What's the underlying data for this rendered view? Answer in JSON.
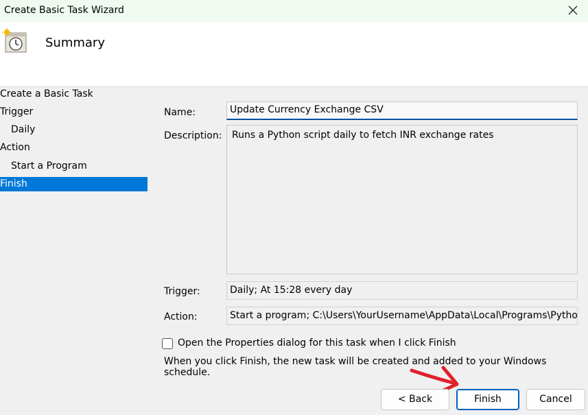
{
  "window": {
    "title": "Create Basic Task Wizard",
    "close_glyph": "✕"
  },
  "header": {
    "title": "Summary",
    "icon": "task-scheduler-clock-icon"
  },
  "nav": {
    "items": [
      {
        "label": "Create a Basic Task",
        "indent": false,
        "selected": false
      },
      {
        "label": "Trigger",
        "indent": false,
        "selected": false
      },
      {
        "label": "Daily",
        "indent": true,
        "selected": false
      },
      {
        "label": "Action",
        "indent": false,
        "selected": false
      },
      {
        "label": "Start a Program",
        "indent": true,
        "selected": false
      },
      {
        "label": "Finish",
        "indent": false,
        "selected": true
      }
    ]
  },
  "form": {
    "name_label": "Name:",
    "name_value": "Update Currency Exchange CSV",
    "description_label": "Description:",
    "description_value": "Runs a Python script daily to fetch INR exchange rates",
    "trigger_label": "Trigger:",
    "trigger_value": "Daily; At 15:28 every day",
    "action_label": "Action:",
    "action_value": "Start a program; C:\\Users\\YourUsername\\AppData\\Local\\Programs\\Python\\Pyth",
    "open_properties_label": "Open the Properties dialog for this task when I click Finish",
    "open_properties_checked": false,
    "info_text": "When you click Finish, the new task will be created and added to your Windows schedule."
  },
  "buttons": {
    "back": "< Back",
    "finish": "Finish",
    "cancel": "Cancel"
  },
  "colors": {
    "selection": "#0078d7",
    "annotation_arrow": "#e0202a",
    "titlebar_bg": "#f0faf0"
  }
}
